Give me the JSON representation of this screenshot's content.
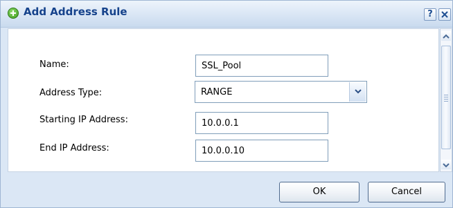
{
  "dialog": {
    "title": "Add Address Rule",
    "help_label": "?"
  },
  "form": {
    "name": {
      "label": "Name:",
      "value": "SSL_Pool"
    },
    "address_type": {
      "label": "Address Type:",
      "value": "RANGE"
    },
    "starting_ip": {
      "label": "Starting IP Address:",
      "value": "10.0.0.1"
    },
    "end_ip": {
      "label": "End IP Address:",
      "value": "10.0.0.10"
    }
  },
  "buttons": {
    "ok": "OK",
    "cancel": "Cancel"
  },
  "icons": {
    "title": "add-icon",
    "help": "help-icon",
    "close": "close-icon",
    "dropdown": "chevron-down-icon",
    "scroll_up": "scroll-up-icon",
    "scroll_down": "scroll-down-icon"
  },
  "colors": {
    "title_text": "#15428b",
    "accent": "#3e9a1f",
    "background": "#dbe7f5"
  }
}
